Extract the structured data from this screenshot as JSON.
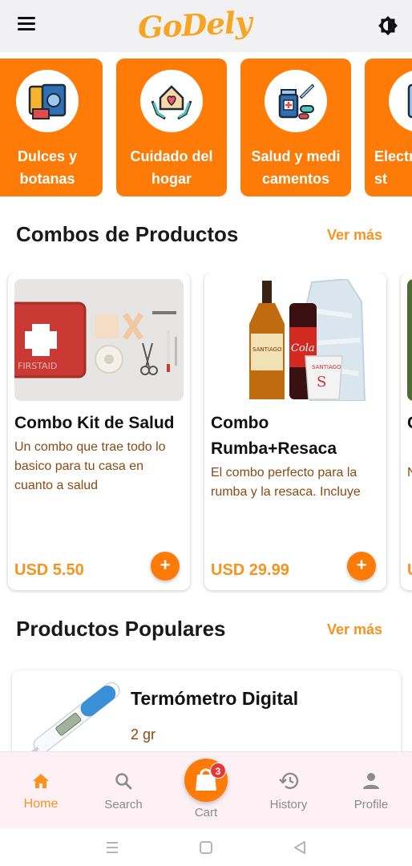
{
  "app": {
    "logo_text": "GoDely"
  },
  "categories": [
    {
      "label": "Dulces y\nbotanas",
      "icon": "snacks-icon"
    },
    {
      "label": "Cuidado del\nhogar",
      "icon": "home-care-icon"
    },
    {
      "label": "Salud y medi\ncamentos",
      "icon": "medicine-icon"
    },
    {
      "label": "Electr\nst",
      "icon": "appliance-icon"
    }
  ],
  "combos_section": {
    "title": "Combos de Productos",
    "see_more": "Ver más"
  },
  "combos": [
    {
      "name": "Combo Kit de Salud",
      "description": "Un combo que trae todo lo basico para tu casa en cuanto a salud",
      "price": "USD 5.50",
      "add": "+"
    },
    {
      "name": "Combo Rumba+Resaca",
      "description": "El combo perfecto para la rumba y la resaca. Incluye una selección de bebidas ...",
      "price": "USD 29.99",
      "add": "+"
    },
    {
      "name": "C e",
      "description": "N p",
      "price": "U",
      "add": ""
    }
  ],
  "popular_section": {
    "title": "Productos Populares",
    "see_more": "Ver más"
  },
  "popular": [
    {
      "name": "Termómetro Digital",
      "weight": "2 gr"
    }
  ],
  "bottom_nav": {
    "home": "Home",
    "search": "Search",
    "cart": "Cart",
    "cart_badge": "3",
    "history": "History",
    "profile": "Profile"
  },
  "colors": {
    "accent": "#ff7b07",
    "accent_text": "#f7931e",
    "desc_text": "#8a4a13",
    "logo": "#f7a520"
  }
}
